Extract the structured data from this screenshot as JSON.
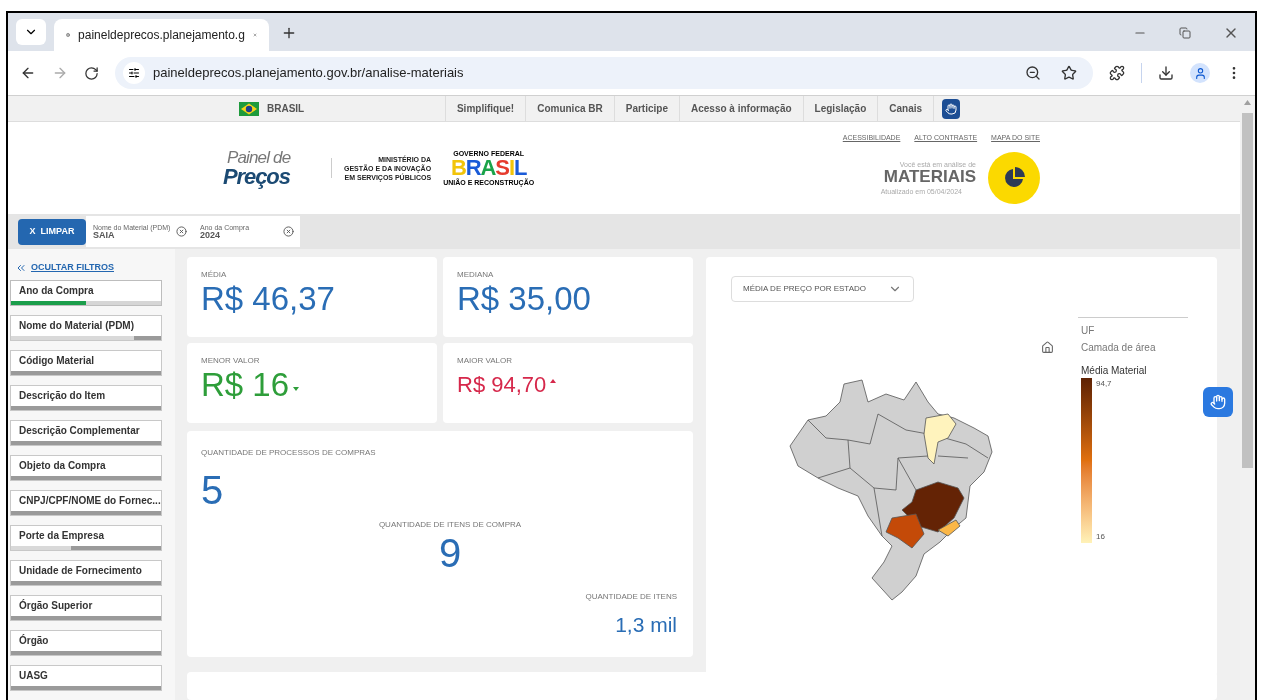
{
  "browser": {
    "tab_title": "paineldeprecos.planejamento.g",
    "url": "paineldeprecos.planejamento.gov.br/analise-materiais"
  },
  "gov_bar": {
    "country": "BRASIL",
    "links": [
      "Simplifique!",
      "Comunica BR",
      "Participe",
      "Acesso à informação",
      "Legislação",
      "Canais"
    ]
  },
  "header": {
    "logo_top": "Painel de",
    "logo_bottom": "Preços",
    "ministry": [
      "MINISTÉRIO DA",
      "GESTÃO E DA INOVAÇÃO",
      "EM SERVIÇOS PÚBLICOS"
    ],
    "gov_top": "GOVERNO FEDERAL",
    "gov_word": "BRASIL",
    "gov_bottom": "UNIÃO E RECONSTRUÇÃO",
    "links": [
      "ACESSIBILIDADE",
      "ALTO CONTRASTE",
      "MAPA DO SITE"
    ],
    "context_label": "Você está em análise de",
    "context_title": "MATERIAIS",
    "updated": "Atualizado em 05/04/2024"
  },
  "filter_bar": {
    "clear_button": "X  LIMPAR",
    "chips": [
      {
        "label": "Nome do Material (PDM)",
        "value": "SAIA"
      },
      {
        "label": "Ano da Compra",
        "value": "2024"
      }
    ]
  },
  "sidebar": {
    "hide_link": "OCULTAR FILTROS",
    "filters": [
      {
        "label": "Ano da Compra",
        "active": true,
        "level": 0.5
      },
      {
        "label": "Nome do Material (PDM)",
        "active": false,
        "level": 0.82
      },
      {
        "label": "Código Material",
        "active": false
      },
      {
        "label": "Descrição do Item",
        "active": false
      },
      {
        "label": "Descrição Complementar",
        "active": false
      },
      {
        "label": "Objeto da Compra",
        "active": false
      },
      {
        "label": "CNPJ/CPF/NOME do Fornec...",
        "active": false
      },
      {
        "label": "Porte da Empresa",
        "active": false,
        "level": 0.4
      },
      {
        "label": "Unidade de Fornecimento",
        "active": false
      },
      {
        "label": "Órgão Superior",
        "active": false
      },
      {
        "label": "Órgão",
        "active": false
      },
      {
        "label": "UASG",
        "active": false
      }
    ]
  },
  "kpis": [
    {
      "label": "MÉDIA",
      "value": "R$ 46,37",
      "kind": "plain"
    },
    {
      "label": "MEDIANA",
      "value": "R$ 35,00",
      "kind": "plain"
    },
    {
      "label": "MENOR VALOR",
      "value": "R$ 16",
      "kind": "low"
    },
    {
      "label": "MAIOR VALOR",
      "value": "R$ 94,70",
      "kind": "high"
    }
  ],
  "counts": [
    {
      "label": "QUANTIDADE DE PROCESSOS DE COMPRAS",
      "value": "5"
    },
    {
      "label": "QUANTIDADE DE ITENS DE COMPRA",
      "value": "9"
    },
    {
      "label": "QUANTIDADE DE ITENS",
      "value": "1,3 mil"
    }
  ],
  "map": {
    "dropdown": "MÉDIA DE PREÇO POR ESTADO",
    "legend_title": "UF",
    "legend_layer": "Camada de área",
    "legend_measure": "Média Material",
    "legend_max": "94,7",
    "legend_min": "16"
  }
}
